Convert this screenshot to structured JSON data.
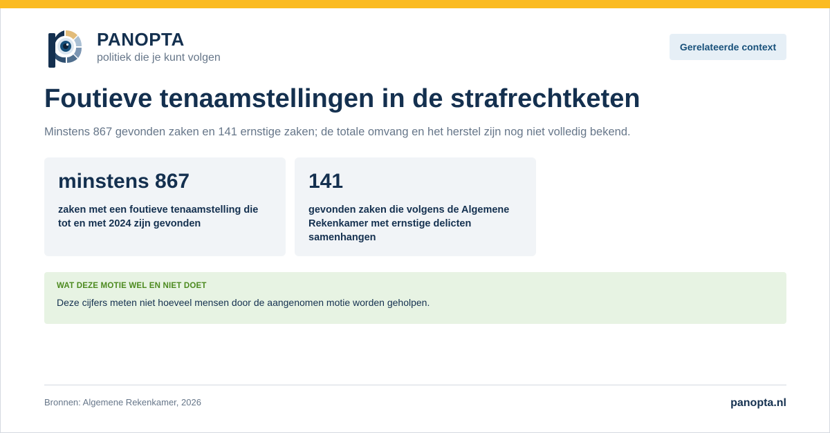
{
  "colors": {
    "accent_bar": "#fbbb21",
    "brand_navy": "#14304f",
    "muted_text": "#667689",
    "card_bg": "#f1f4f7",
    "note_bg": "#e7f3e3",
    "note_label": "#4c8a1f",
    "button_bg": "#e6eff6",
    "button_text": "#17507a"
  },
  "header": {
    "logo_icon": "panopta-eye-logo-icon",
    "brand_name": "PANOPTA",
    "tagline": "politiek die je kunt volgen",
    "context_button_label": "Gerelateerde context"
  },
  "main": {
    "title": "Foutieve tenaamstellingen in de strafrechtketen",
    "subtitle": "Minstens 867 gevonden zaken en 141 ernstige zaken; de totale omvang en het herstel zijn nog niet volledig bekend.",
    "stats": [
      {
        "value": "minstens 867",
        "description": "zaken met een foutieve tenaamstelling die tot en met 2024 zijn gevonden"
      },
      {
        "value": "141",
        "description": "gevonden zaken die volgens de Algemene Rekenkamer met ernstige delicten samenhangen"
      }
    ]
  },
  "note": {
    "label": "WAT DEZE MOTIE WEL EN NIET DOET",
    "text": "Deze cijfers meten niet hoeveel mensen door de aangenomen motie worden geholpen."
  },
  "footer": {
    "sources": "Bronnen: Algemene Rekenkamer, 2026",
    "site": "panopta.nl"
  }
}
